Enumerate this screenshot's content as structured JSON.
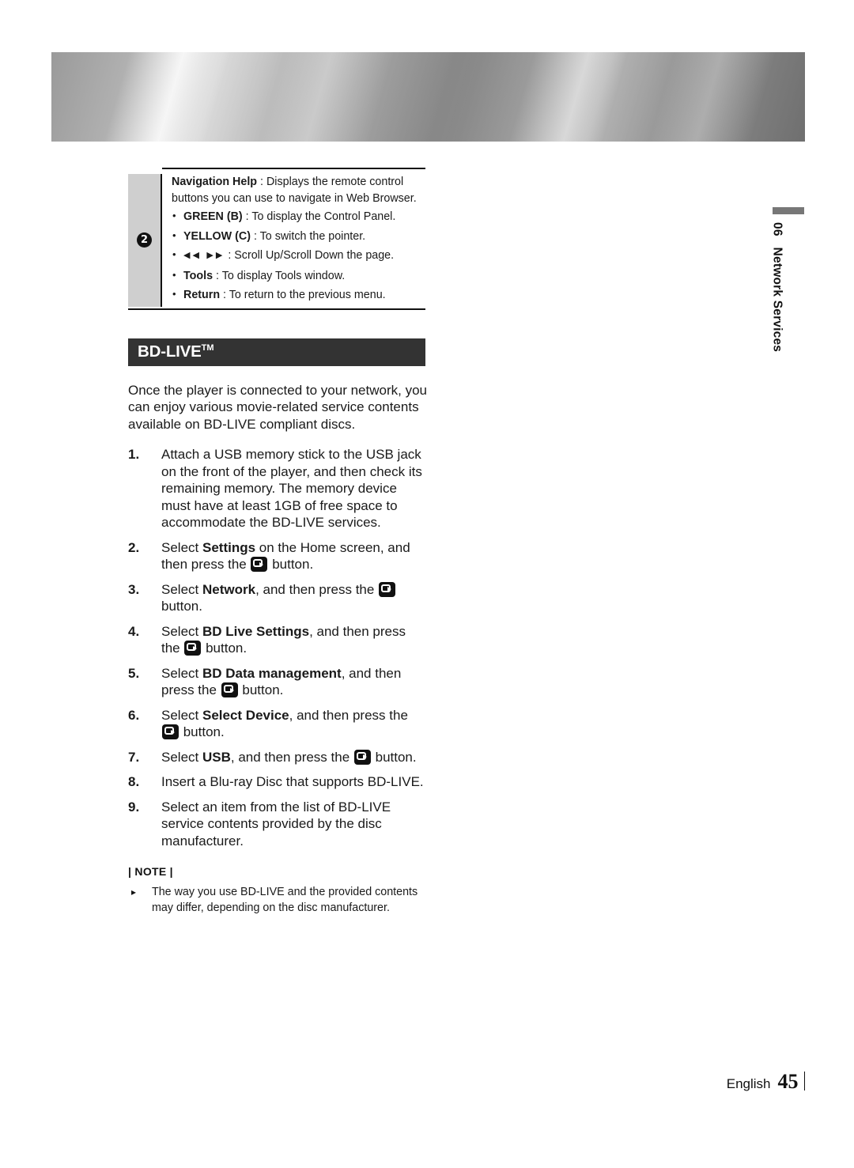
{
  "banner": {
    "name": "metallic-header-band"
  },
  "side_tab": {
    "chapter_number": "06",
    "chapter_title": "Network Services"
  },
  "nav_table": {
    "marker": "2",
    "lead_bold": "Navigation Help",
    "lead_rest": " : Displays the remote control buttons you can use to navigate in Web Browser.",
    "bullets": [
      {
        "bold": "GREEN (B)",
        "rest": " : To display the Control Panel."
      },
      {
        "bold": "YELLOW (C)",
        "rest": " : To switch the pointer."
      },
      {
        "bold": "",
        "icons": "◀◀  ▶▶",
        "rest": " : Scroll Up/Scroll Down the page."
      },
      {
        "bold": "Tools",
        "rest": " : To display Tools window."
      },
      {
        "bold": "Return",
        "rest": " : To return to the previous menu."
      }
    ]
  },
  "section": {
    "heading": "BD-LIVE",
    "heading_sup": "TM",
    "intro": "Once the player is connected to your network, you can enjoy various movie-related service contents available on BD-LIVE compliant discs."
  },
  "steps": [
    {
      "num": "1.",
      "parts": [
        {
          "t": "text",
          "v": "Attach a USB memory stick to the USB jack on the front of the player, and then check its remaining memory. The memory device must have at least 1GB of free space to accommodate the BD-LIVE services."
        }
      ]
    },
    {
      "num": "2.",
      "parts": [
        {
          "t": "text",
          "v": "Select "
        },
        {
          "t": "bold",
          "v": "Settings"
        },
        {
          "t": "text",
          "v": " on the Home screen, and then press the "
        },
        {
          "t": "icon",
          "v": "enter-button-icon"
        },
        {
          "t": "text",
          "v": " button."
        }
      ]
    },
    {
      "num": "3.",
      "parts": [
        {
          "t": "text",
          "v": "Select "
        },
        {
          "t": "bold",
          "v": "Network"
        },
        {
          "t": "text",
          "v": ", and then press the "
        },
        {
          "t": "icon",
          "v": "enter-button-icon"
        },
        {
          "t": "text",
          "v": " button."
        }
      ]
    },
    {
      "num": "4.",
      "parts": [
        {
          "t": "text",
          "v": "Select "
        },
        {
          "t": "bold",
          "v": "BD Live Settings"
        },
        {
          "t": "text",
          "v": ", and then press the "
        },
        {
          "t": "icon",
          "v": "enter-button-icon"
        },
        {
          "t": "text",
          "v": " button."
        }
      ]
    },
    {
      "num": "5.",
      "parts": [
        {
          "t": "text",
          "v": "Select "
        },
        {
          "t": "bold",
          "v": "BD Data management"
        },
        {
          "t": "text",
          "v": ", and then press the "
        },
        {
          "t": "icon",
          "v": "enter-button-icon"
        },
        {
          "t": "text",
          "v": " button."
        }
      ]
    },
    {
      "num": "6.",
      "parts": [
        {
          "t": "text",
          "v": "Select "
        },
        {
          "t": "bold",
          "v": "Select Device"
        },
        {
          "t": "text",
          "v": ", and then press the "
        },
        {
          "t": "icon",
          "v": "enter-button-icon"
        },
        {
          "t": "text",
          "v": " button."
        }
      ]
    },
    {
      "num": "7.",
      "parts": [
        {
          "t": "text",
          "v": "Select "
        },
        {
          "t": "bold",
          "v": "USB"
        },
        {
          "t": "text",
          "v": ", and then press the "
        },
        {
          "t": "icon",
          "v": "enter-button-icon"
        },
        {
          "t": "text",
          "v": " button."
        }
      ]
    },
    {
      "num": "8.",
      "parts": [
        {
          "t": "text",
          "v": "Insert a Blu-ray Disc that supports BD-LIVE."
        }
      ]
    },
    {
      "num": "9.",
      "parts": [
        {
          "t": "text",
          "v": "Select an item from the list of BD-LIVE service contents provided by the disc manufacturer."
        }
      ]
    }
  ],
  "note": {
    "heading": "| NOTE |",
    "items": [
      "The way you use BD-LIVE and the provided contents may differ, depending on the disc manufacturer."
    ]
  },
  "footer": {
    "language": "English",
    "page": "45"
  },
  "colors": {
    "heading_bar": "#333333",
    "table_cell": "#cfcfcf",
    "side_tab_bar": "#777777",
    "text": "#1a1a1a"
  }
}
